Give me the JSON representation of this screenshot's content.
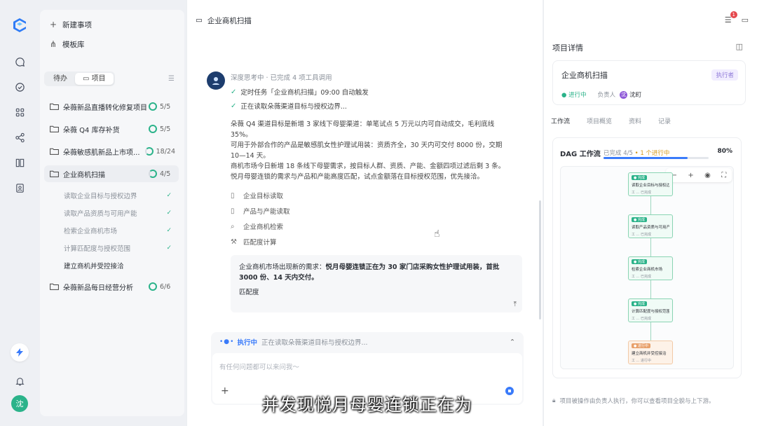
{
  "sidebar": {
    "new_item": "新建事项",
    "templates": "模板库",
    "tabs": [
      "待办",
      "项目"
    ],
    "projects": [
      {
        "name": "朵薇新品直播转化修复项目",
        "count": "5/5"
      },
      {
        "name": "朵薇 Q4 库存补货",
        "count": "5/5"
      },
      {
        "name": "朵薇敏感肌新品上市项...",
        "count": "18/24"
      },
      {
        "name": "企业商机扫描",
        "count": "4/5"
      },
      {
        "name": "朵薇新品每日经营分析",
        "count": "6/6"
      }
    ],
    "subtasks": [
      "读取企业目标与授权边界",
      "读取产品资质与可用产能",
      "检索企业商机市场",
      "计算匹配度与授权范围",
      "建立商机并受控接洽"
    ],
    "user_initial": "沈"
  },
  "main": {
    "title": "企业商机扫描",
    "thinking": "深度思考中 · 已完成 4 项工具调用",
    "steps": [
      "定时任务「企业商机扫描」09:00 自动触发",
      "正在读取朵薇渠道目标与授权边界..."
    ],
    "paragraph_lines": [
      "朵薇 Q4 渠道目标是新增 3 家线下母婴渠道：单笔试点 5 万元以内可自动成交，毛利底线",
      "35%。",
      "可用于外部合作的产品是敏感肌女性护理试用装：资质齐全，30 天内可交付 8000 份，交期",
      "10—14 天。",
      "商机市场今日新增 18 条线下母婴需求，按目标人群、资质、产能、金额四项过滤后剩 3 条。",
      "悦月母婴连锁的需求与产品和产能高度匹配，试点金额落在目标授权范围，优先接洽。"
    ],
    "tools": [
      "企业目标读取",
      "产品与产能读取",
      "企业商机检索",
      "匹配度计算"
    ],
    "card": {
      "prefix": "企业商机市场出现新的需求：",
      "bold": "悦月母婴连锁正在为 30 家门店采购女性护理试用装",
      "suffix_bold": "，首批",
      "line2": "3000 份、14 天内交付。",
      "label": "匹配度"
    },
    "composer": {
      "status": "执行中",
      "status_text": "正在读取朵薇渠道目标与授权边界...",
      "placeholder": "有任何问题都可以来问我～"
    },
    "subtitle": "并发现悦月母婴连锁正在为"
  },
  "detail": {
    "title": "项目详情",
    "notification_count": "1",
    "project_name": "企业商机扫描",
    "status_tag": "执行者",
    "running": "进行中",
    "owner_label": "负责人",
    "owner": "沈町",
    "tabs": [
      "工作流",
      "项目概览",
      "资料",
      "记录"
    ],
    "dag": {
      "title": "DAG 工作流",
      "done": "已完成 4/5",
      "in_progress": "1 个进行中",
      "percent": "80%",
      "progress_fraction": 0.8,
      "nodes": [
        {
          "chip": "● 完成",
          "title": "读取企业目标与授权边界",
          "footer": "工 ... 已完成"
        },
        {
          "chip": "● 完成",
          "title": "读取产品资质与可用产能",
          "footer": "工 ... 已完成"
        },
        {
          "chip": "● 完成",
          "title": "检索企业商机市场",
          "footer": "工 ... 已完成"
        },
        {
          "chip": "● 完成",
          "title": "计算匹配度与授权范围",
          "footer": "工 ... 已完成"
        },
        {
          "chip": "● 进行中",
          "title": "建立商机并受控接洽",
          "footer": "工 ... 进行中",
          "pending": true
        }
      ]
    },
    "footer": "项目被操作由负责人执行，你可以查看项目全貌与上下游。"
  }
}
